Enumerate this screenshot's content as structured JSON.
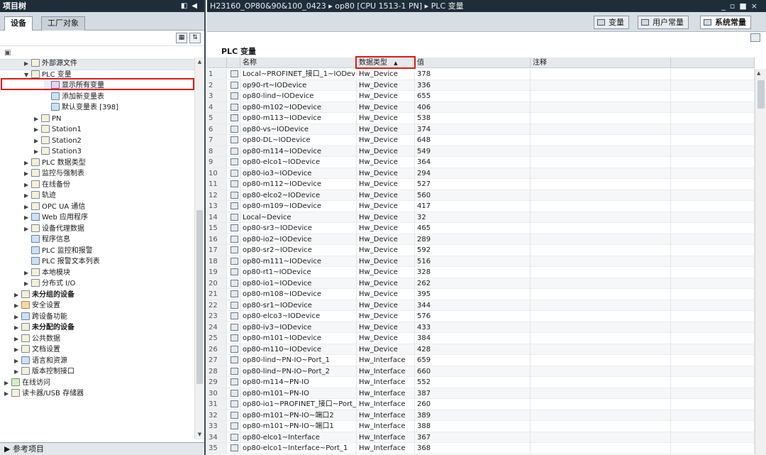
{
  "left": {
    "title": "项目树",
    "title_buttons": "◧◀",
    "tabs": [
      "设备",
      "工厂对象"
    ],
    "tree": [
      {
        "label": "外部源文件",
        "indent": 3,
        "arrow": "▶",
        "icon": "yellow"
      },
      {
        "label": "PLC 变量",
        "indent": 3,
        "arrow": "▼",
        "icon": "yellow"
      },
      {
        "label": "显示所有变量",
        "indent": 5,
        "arrow": "",
        "icon": "purple",
        "selected": true
      },
      {
        "label": "添加新变量表",
        "indent": 5,
        "arrow": "",
        "icon": "blue"
      },
      {
        "label": "默认变量表 [398]",
        "indent": 5,
        "arrow": "",
        "icon": "blue"
      },
      {
        "label": "PN",
        "indent": 4,
        "arrow": "▶",
        "icon": "yellow"
      },
      {
        "label": "Station1",
        "indent": 4,
        "arrow": "▶",
        "icon": "yellow"
      },
      {
        "label": "Station2",
        "indent": 4,
        "arrow": "▶",
        "icon": "yellow"
      },
      {
        "label": "Station3",
        "indent": 4,
        "arrow": "▶",
        "icon": "yellow"
      },
      {
        "label": "PLC 数据类型",
        "indent": 3,
        "arrow": "▶",
        "icon": "yellow"
      },
      {
        "label": "监控与强制表",
        "indent": 3,
        "arrow": "▶",
        "icon": "yellow"
      },
      {
        "label": "在线备份",
        "indent": 3,
        "arrow": "▶",
        "icon": "yellow"
      },
      {
        "label": "轨迹",
        "indent": 3,
        "arrow": "▶",
        "icon": "yellow"
      },
      {
        "label": "OPC UA 通信",
        "indent": 3,
        "arrow": "▶",
        "icon": "yellow"
      },
      {
        "label": "Web 应用程序",
        "indent": 3,
        "arrow": "▶",
        "icon": "blue"
      },
      {
        "label": "设备代理数据",
        "indent": 3,
        "arrow": "▶",
        "icon": "yellow"
      },
      {
        "label": "程序信息",
        "indent": 3,
        "arrow": "",
        "icon": "blue"
      },
      {
        "label": "PLC 监控和报警",
        "indent": 3,
        "arrow": "",
        "icon": "blue"
      },
      {
        "label": "PLC 报警文本列表",
        "indent": 3,
        "arrow": "",
        "icon": "blue"
      },
      {
        "label": "本地模块",
        "indent": 3,
        "arrow": "▶",
        "icon": "yellow"
      },
      {
        "label": "分布式 I/O",
        "indent": 3,
        "arrow": "▶",
        "icon": "yellow"
      },
      {
        "label": "未分组的设备",
        "indent": 2,
        "arrow": "▶",
        "icon": "yellow",
        "bold": true
      },
      {
        "label": "安全设置",
        "indent": 2,
        "arrow": "▶",
        "icon": "orange"
      },
      {
        "label": "跨设备功能",
        "indent": 2,
        "arrow": "▶",
        "icon": "blue"
      },
      {
        "label": "未分配的设备",
        "indent": 2,
        "arrow": "▶",
        "icon": "yellow",
        "bold": true
      },
      {
        "label": "公共数据",
        "indent": 2,
        "arrow": "▶",
        "icon": "yellow"
      },
      {
        "label": "文档设置",
        "indent": 2,
        "arrow": "▶",
        "icon": "yellow"
      },
      {
        "label": "语言和资源",
        "indent": 2,
        "arrow": "▶",
        "icon": "blue"
      },
      {
        "label": "版本控制接口",
        "indent": 2,
        "arrow": "▶",
        "icon": "yellow"
      },
      {
        "label": "在线访问",
        "indent": 1,
        "arrow": "▶",
        "icon": "green"
      },
      {
        "label": "读卡器/USB 存储器",
        "indent": 1,
        "arrow": "▶",
        "icon": "yellow"
      }
    ],
    "bottom": "参考项目",
    "bottom_arrow": "▶"
  },
  "editor": {
    "breadcrumb": "H23160_OP80&90&100_0423 ▸ op80 [CPU 1513-1 PN] ▸ PLC 变量",
    "window_buttons": "_▫■×",
    "tabs": [
      "变量",
      "用户常量",
      "系统常量"
    ],
    "section_title": "PLC 变量",
    "columns": {
      "name": "名称",
      "type": "数据类型",
      "sort_indicator": "▲",
      "value": "值",
      "comment": "注释"
    },
    "rows": [
      [
        "1",
        "Local~PROFINET_接口_1~IODevice",
        "Hw_Device",
        "378"
      ],
      [
        "2",
        "op90-rt~IODevice",
        "Hw_Device",
        "336"
      ],
      [
        "3",
        "op80-lind~IODevice",
        "Hw_Device",
        "655"
      ],
      [
        "4",
        "op80-m102~IODevice",
        "Hw_Device",
        "406"
      ],
      [
        "5",
        "op80-m113~IODevice",
        "Hw_Device",
        "538"
      ],
      [
        "6",
        "op80-vs~IODevice",
        "Hw_Device",
        "374"
      ],
      [
        "7",
        "op80-DL~IODevice",
        "Hw_Device",
        "648"
      ],
      [
        "8",
        "op80-m114~IODevice",
        "Hw_Device",
        "549"
      ],
      [
        "9",
        "op80-elco1~IODevice",
        "Hw_Device",
        "364"
      ],
      [
        "10",
        "op80-io3~IODevice",
        "Hw_Device",
        "294"
      ],
      [
        "11",
        "op80-m112~IODevice",
        "Hw_Device",
        "527"
      ],
      [
        "12",
        "op80-elco2~IODevice",
        "Hw_Device",
        "560"
      ],
      [
        "13",
        "op80-m109~IODevice",
        "Hw_Device",
        "417"
      ],
      [
        "14",
        "Local~Device",
        "Hw_Device",
        "32"
      ],
      [
        "15",
        "op80-sr3~IODevice",
        "Hw_Device",
        "465"
      ],
      [
        "16",
        "op80-io2~IODevice",
        "Hw_Device",
        "289"
      ],
      [
        "17",
        "op80-sr2~IODevice",
        "Hw_Device",
        "592"
      ],
      [
        "18",
        "op80-m111~IODevice",
        "Hw_Device",
        "516"
      ],
      [
        "19",
        "op80-rt1~IODevice",
        "Hw_Device",
        "328"
      ],
      [
        "20",
        "op80-io1~IODevice",
        "Hw_Device",
        "262"
      ],
      [
        "21",
        "op80-m108~IODevice",
        "Hw_Device",
        "395"
      ],
      [
        "22",
        "op80-sr1~IODevice",
        "Hw_Device",
        "344"
      ],
      [
        "23",
        "op80-elco3~IODevice",
        "Hw_Device",
        "576"
      ],
      [
        "24",
        "op80-iv3~IODevice",
        "Hw_Device",
        "433"
      ],
      [
        "25",
        "op80-m101~IODevice",
        "Hw_Device",
        "384"
      ],
      [
        "26",
        "op80-m110~IODevice",
        "Hw_Device",
        "428"
      ],
      [
        "27",
        "op80-lind~PN-IO~Port_1",
        "Hw_Interface",
        "659"
      ],
      [
        "28",
        "op80-lind~PN-IO~Port_2",
        "Hw_Interface",
        "660"
      ],
      [
        "29",
        "op80-m114~PN-IO",
        "Hw_Interface",
        "552"
      ],
      [
        "30",
        "op80-m101~PN-IO",
        "Hw_Interface",
        "387"
      ],
      [
        "31",
        "op80-io1~PROFINET_接口~Port_1",
        "Hw_Interface",
        "260"
      ],
      [
        "32",
        "op80-m101~PN-IO~端口2",
        "Hw_Interface",
        "389"
      ],
      [
        "33",
        "op80-m101~PN-IO~端口1",
        "Hw_Interface",
        "388"
      ],
      [
        "34",
        "op80-elco1~Interface",
        "Hw_Interface",
        "367"
      ],
      [
        "35",
        "op80-elco1~Interface~Port_1",
        "Hw_Interface",
        "368"
      ]
    ]
  },
  "colors": {
    "title_bar": "#1e2d3a",
    "highlight": "#e01a1a",
    "header_bg": "#e6e9ec"
  }
}
